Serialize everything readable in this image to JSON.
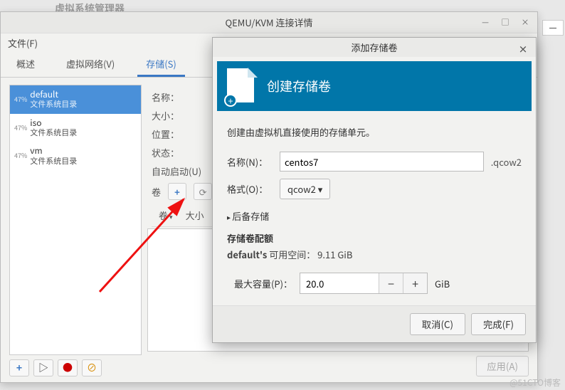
{
  "bg_title": "虚拟系统管理器",
  "main": {
    "title": "QEMU/KVM 连接详情",
    "menu_file": "文件(F)",
    "tabs": {
      "overview": "概述",
      "vnets": "虚拟网络(V)",
      "storage": "存储(S)"
    },
    "pools": [
      {
        "pct": "47%",
        "name": "default",
        "sub": "文件系统目录",
        "selected": true
      },
      {
        "pct": "47%",
        "name": "iso",
        "sub": "文件系统目录",
        "selected": false
      },
      {
        "pct": "47%",
        "name": "vm",
        "sub": "文件系统目录",
        "selected": false
      }
    ],
    "detail": {
      "name_label": "名称：",
      "size_label": "大小：",
      "loc_label": "位置：",
      "state_label": "状态：",
      "autostart_label": "自动启动(U)",
      "vol_label": "卷",
      "col_name": "卷",
      "col_size": "大小"
    },
    "apply": "应用(A)"
  },
  "dialog": {
    "title": "添加存储卷",
    "banner": "创建存储卷",
    "desc": "创建由虚拟机直接使用的存储单元。",
    "name_label": "名称(N)：",
    "name_value": "centos7",
    "ext": ".qcow2",
    "fmt_label": "格式(O)：",
    "fmt_value": "qcow2",
    "backing": "后备存储",
    "quota_title": "存储卷配额",
    "quota_pool": "default's",
    "quota_avail_label": "可用空间：",
    "quota_avail": "9.11 GiB",
    "cap_label": "最大容量(P)：",
    "cap_value": "20.0",
    "cap_unit": "GiB",
    "cancel": "取消(C)",
    "finish": "完成(F)"
  },
  "watermark": "@51CTO博客"
}
